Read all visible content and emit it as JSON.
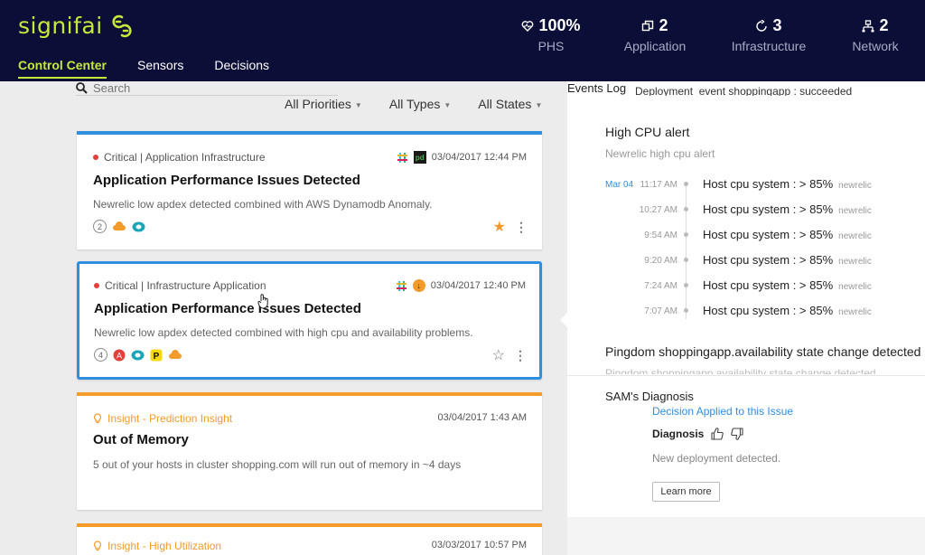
{
  "app": {
    "brand": "signifai",
    "brand_color": "#c7e83a",
    "header_bg": "#0b0e36"
  },
  "nav": {
    "items": [
      {
        "label": "Control Center",
        "active": true
      },
      {
        "label": "Sensors",
        "active": false
      },
      {
        "label": "Decisions",
        "active": false
      }
    ]
  },
  "metrics": [
    {
      "value": "100%",
      "label": "PHS",
      "icon": "heart-pulse-icon"
    },
    {
      "value": "2",
      "label": "Application",
      "icon": "windows-icon"
    },
    {
      "value": "3",
      "label": "Infrastructure",
      "icon": "cycle-icon"
    },
    {
      "value": "2",
      "label": "Network",
      "icon": "network-icon"
    }
  ],
  "search": {
    "placeholder": "Search"
  },
  "filters": [
    "All Priorities",
    "All Types",
    "All States"
  ],
  "cards": [
    {
      "meta": "Critical | Application Infrastructure",
      "date": "03/04/2017 12:44 PM",
      "title": "Application Performance Issues Detected",
      "desc": "Newrelic low apdex detected combined with AWS Dynamodb Anomaly.",
      "count": "2",
      "starred": true
    },
    {
      "meta": "Critical | Infrastructure Application",
      "date": "03/04/2017 12:40 PM",
      "title": "Application Performance Issues Detected",
      "desc": "Newrelic low apdex detected combined with high cpu and availability problems.",
      "count": "4",
      "starred": false
    },
    {
      "meta": "Insight - Prediction Insight",
      "date": "03/04/2017 1:43 AM",
      "title": "Out of Memory",
      "desc": "5 out of your hosts in cluster shopping.com will run out of memory in ~4 days"
    },
    {
      "meta": "Insight - High Utilization",
      "date": "03/03/2017 10:57 PM"
    }
  ],
  "events": {
    "label": "Events Log",
    "cut_text": "Deployment_event shoppingapp : succeeded",
    "alert_title": "High CPU alert",
    "alert_sub": "Newrelic high cpu alert",
    "timeline_date": "Mar 04",
    "timeline": [
      {
        "time": "11:17 AM",
        "msg": "Host cpu system : > 85%",
        "src": "newrelic"
      },
      {
        "time": "10:27 AM",
        "msg": "Host cpu system : > 85%",
        "src": "newrelic"
      },
      {
        "time": "9:54 AM",
        "msg": "Host cpu system : > 85%",
        "src": "newrelic"
      },
      {
        "time": "9:20 AM",
        "msg": "Host cpu system : > 85%",
        "src": "newrelic"
      },
      {
        "time": "7:24 AM",
        "msg": "Host cpu system : > 85%",
        "src": "newrelic"
      },
      {
        "time": "7:07 AM",
        "msg": "Host cpu system : > 85%",
        "src": "newrelic"
      }
    ],
    "pingdom_title": "Pingdom shoppingapp.availability state change detected",
    "pingdom_sub": "Pingdom shoppingapp.availability state change detected"
  },
  "diagnosis": {
    "title": "SAM's Diagnosis",
    "link": "Decision Applied to this Issue",
    "label": "Diagnosis",
    "text": "New deployment detected.",
    "button": "Learn more"
  }
}
